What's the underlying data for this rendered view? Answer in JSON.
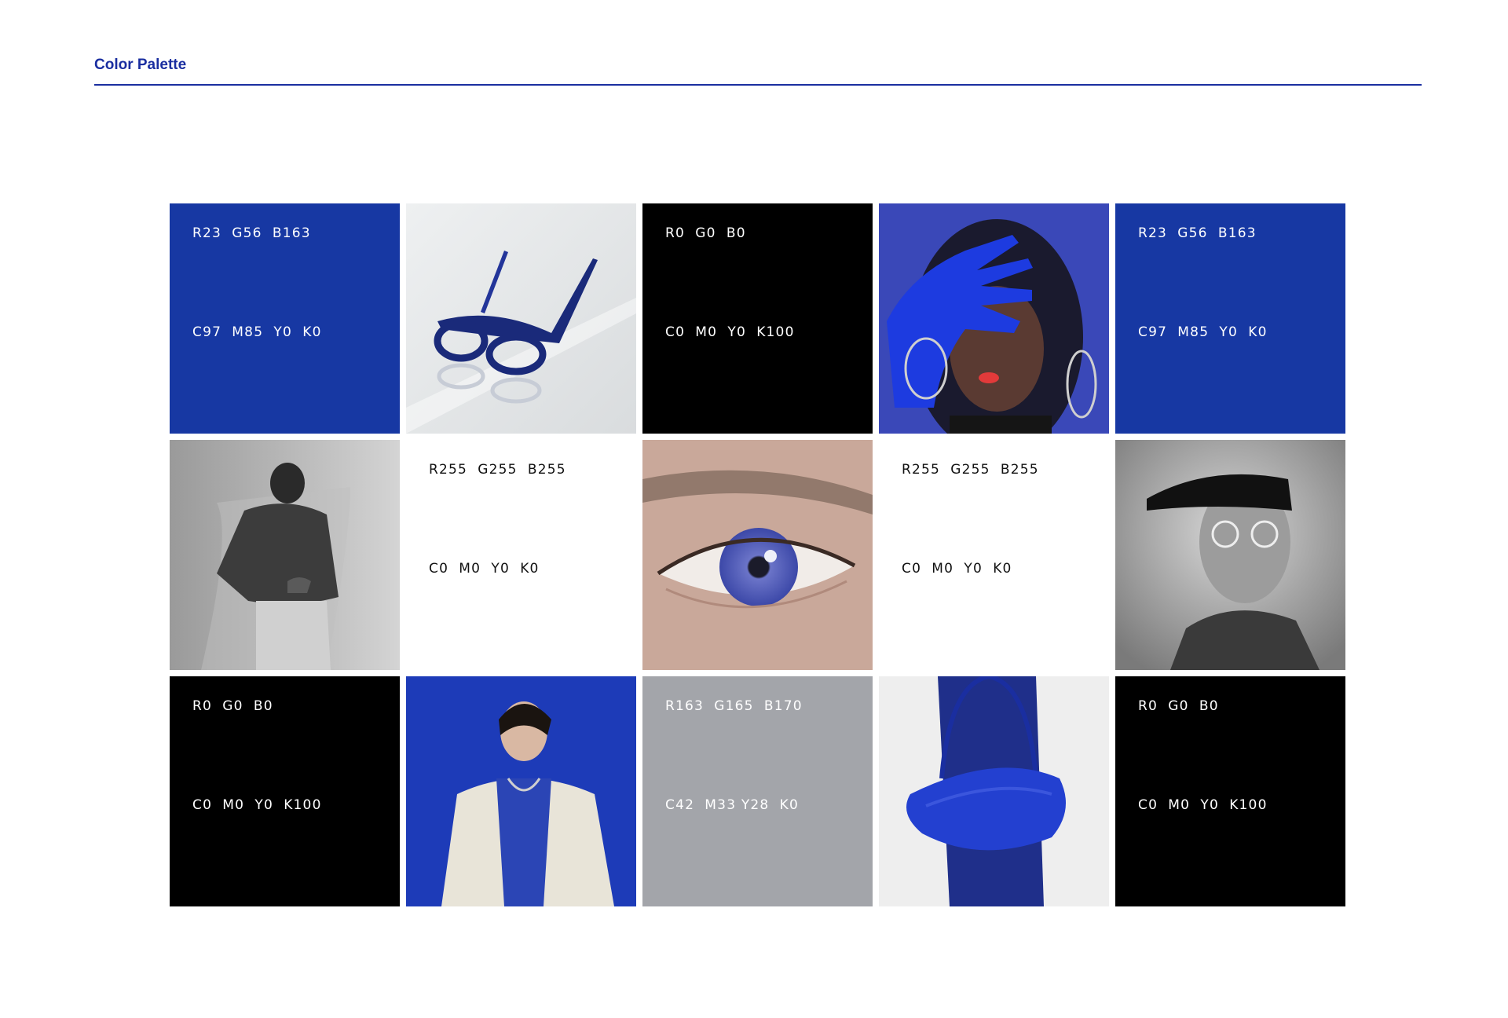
{
  "page": {
    "title": "Color Palette"
  },
  "swatches": {
    "blue1": {
      "rgb": "R23  G56  B163",
      "cmyk": "C97  M85  Y0  K0"
    },
    "black1": {
      "rgb": "R0  G0  B0",
      "cmyk": "C0  M0  Y0  K100"
    },
    "blue2": {
      "rgb": "R23  G56  B163",
      "cmyk": "C97  M85  Y0  K0"
    },
    "white1": {
      "rgb": "R255  G255  B255",
      "cmyk": "C0  M0  Y0  K0"
    },
    "white2": {
      "rgb": "R255  G255  B255",
      "cmyk": "C0  M0  Y0  K0"
    },
    "black2": {
      "rgb": "R0  G0  B0",
      "cmyk": "C0  M0  Y0  K100"
    },
    "gray": {
      "rgb": "R163  G165  B170",
      "cmyk": "C42  M33 Y28  K0"
    },
    "black3": {
      "rgb": "R0  G0  B0",
      "cmyk": "C0  M0  Y0  K100"
    }
  },
  "colors": {
    "brand_blue": "#1738a3",
    "black": "#000000",
    "white": "#ffffff",
    "gray": "#a3a5aa",
    "title": "#1a2ea0"
  },
  "photos": [
    "eyeglasses-photo",
    "gloved-hand-photo",
    "man-back-photo",
    "eye-closeup-photo",
    "man-cap-glasses-photo",
    "man-white-jacket-photo",
    "blue-bag-photo"
  ]
}
